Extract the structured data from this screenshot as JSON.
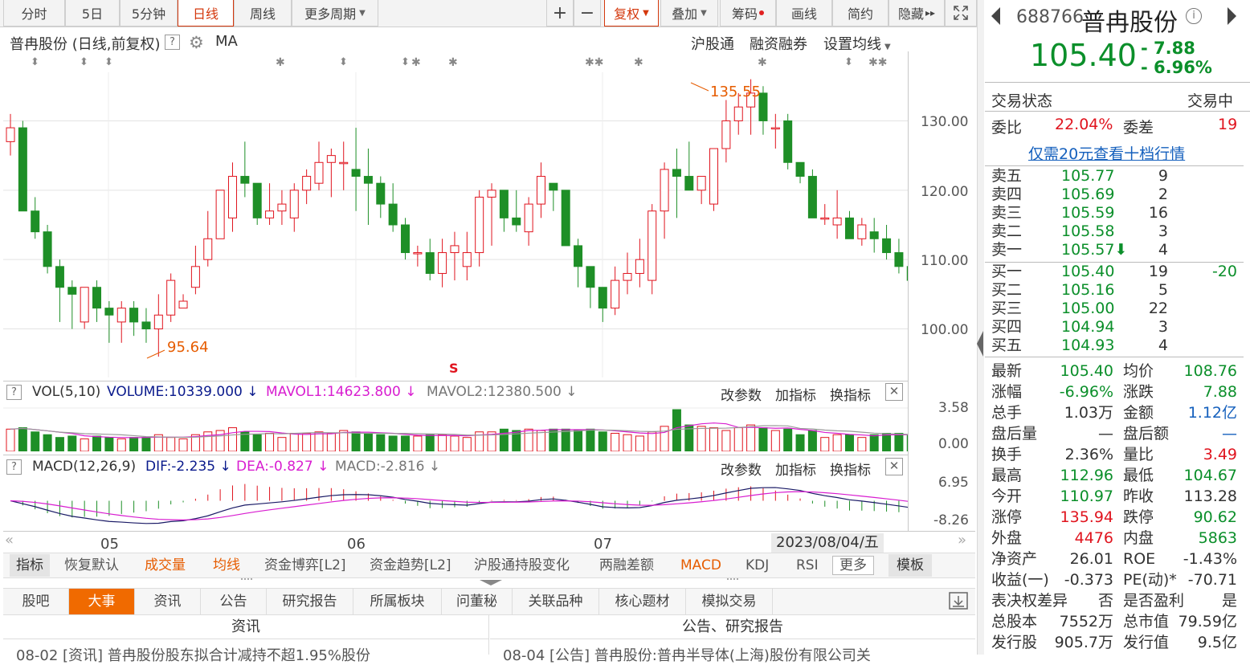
{
  "toolbar": {
    "tabs": [
      "分时",
      "5日",
      "5分钟",
      "日线",
      "周线",
      "更多周期"
    ],
    "right_tools": [
      "+",
      "−",
      "复权",
      "叠加",
      "筹码",
      "画线",
      "简约",
      "隐藏"
    ]
  },
  "chart_header": {
    "title": "普冉股份 (日线,前复权)",
    "ma": "MA",
    "links": [
      "沪股通",
      "融资融券",
      "设置均线"
    ]
  },
  "annotations": {
    "high_label": "135.55",
    "low_label": "95.64",
    "s_marker": "S"
  },
  "price_axis": [
    "130.00",
    "120.00",
    "110.00",
    "100.00"
  ],
  "vol_header": {
    "name": "VOL(5,10)",
    "volume": "VOLUME:10339.000",
    "mavol1": "MAVOL1:14623.800",
    "mavol2": "MAVOL2:12380.500",
    "axis_top": "3.58",
    "axis_bottom": "0.00"
  },
  "macd_header": {
    "name": "MACD(12,26,9)",
    "dif": "DIF:-2.235",
    "dea": "DEA:-0.827",
    "macd": "MACD:-2.816",
    "axis_top": "6.95",
    "axis_bottom": "-8.26"
  },
  "panel_actions": [
    "改参数",
    "加指标",
    "换指标"
  ],
  "time_axis": {
    "months": [
      "05",
      "06",
      "07"
    ],
    "cursor_date": "2023/08/04/五"
  },
  "indicator_tabs": [
    "指标",
    "恢复默认",
    "成交量",
    "均线",
    "资金博弈[L2]",
    "资金趋势[L2]",
    "沪股通持股变化",
    "两融差额",
    "MACD",
    "KDJ",
    "RSI",
    "更多",
    "模板"
  ],
  "bottom_tabs": [
    "股吧",
    "大事",
    "资讯",
    "公告",
    "研究报告",
    "所属板块",
    "问董秘",
    "关联品种",
    "核心题材",
    "模拟交易"
  ],
  "news": {
    "left_header": "资讯",
    "right_header": "公告、研究报告",
    "left_item": "08-02  [资讯]  普冉股份股东拟合计减持不超1.95%股份",
    "right_item": "08-04  [公告]  普冉股份:普冉半导体(上海)股份有限公司关"
  },
  "quote": {
    "code": "688766",
    "name": "普冉股份",
    "price": "105.40",
    "change": "- 7.88",
    "change_pct": "- 6.96%",
    "status_label": "交易状态",
    "status": "交易中",
    "weibi_label": "委比",
    "weibi": "22.04%",
    "weicha_label": "委差",
    "weicha": "19",
    "promo": "仅需20元查看十档行情"
  },
  "order_book": {
    "asks": [
      {
        "label": "卖五",
        "price": "105.77",
        "vol": "9"
      },
      {
        "label": "卖四",
        "price": "105.69",
        "vol": "2"
      },
      {
        "label": "卖三",
        "price": "105.59",
        "vol": "16"
      },
      {
        "label": "卖二",
        "price": "105.58",
        "vol": "3"
      },
      {
        "label": "卖一",
        "price": "105.57",
        "vol": "4"
      }
    ],
    "bids": [
      {
        "label": "买一",
        "price": "105.40",
        "vol": "19",
        "delta": "-20"
      },
      {
        "label": "买二",
        "price": "105.16",
        "vol": "5"
      },
      {
        "label": "买三",
        "price": "105.00",
        "vol": "22"
      },
      {
        "label": "买四",
        "price": "104.94",
        "vol": "3"
      },
      {
        "label": "买五",
        "price": "104.93",
        "vol": "4"
      }
    ]
  },
  "stats": [
    {
      "l1": "最新",
      "v1": "105.40",
      "c1": "green",
      "l2": "均价",
      "v2": "108.76",
      "c2": "green"
    },
    {
      "l1": "涨幅",
      "v1": "-6.96%",
      "c1": "green",
      "l2": "涨跌",
      "v2": "7.88",
      "c2": "green"
    },
    {
      "l1": "总手",
      "v1": "1.03万",
      "c1": "",
      "l2": "金额",
      "v2": "1.12亿",
      "c2": "blue"
    },
    {
      "l1": "盘后量",
      "v1": "—",
      "c1": "",
      "l2": "盘后额",
      "v2": "—",
      "c2": "blue"
    },
    {
      "l1": "换手",
      "v1": "2.36%",
      "c1": "",
      "l2": "量比",
      "v2": "3.49",
      "c2": "red"
    },
    {
      "l1": "最高",
      "v1": "112.96",
      "c1": "green",
      "l2": "最低",
      "v2": "104.67",
      "c2": "green"
    },
    {
      "l1": "今开",
      "v1": "110.97",
      "c1": "green",
      "l2": "昨收",
      "v2": "113.28",
      "c2": ""
    },
    {
      "l1": "涨停",
      "v1": "135.94",
      "c1": "red",
      "l2": "跌停",
      "v2": "90.62",
      "c2": "green"
    },
    {
      "l1": "外盘",
      "v1": "4476",
      "c1": "red",
      "l2": "内盘",
      "v2": "5863",
      "c2": "green"
    },
    {
      "l1": "净资产",
      "v1": "26.01",
      "c1": "",
      "l2": "ROE",
      "v2": "-1.43%",
      "c2": ""
    },
    {
      "l1": "收益(一)",
      "v1": "-0.373",
      "c1": "",
      "l2": "PE(动)*",
      "v2": "-70.71",
      "c2": ""
    },
    {
      "l1": "表决权差异",
      "v1": "否",
      "c1": "",
      "l2": "是否盈利",
      "v2": "是",
      "c2": ""
    },
    {
      "l1": "总股本",
      "v1": "7552万",
      "c1": "",
      "l2": "总市值",
      "v2": "79.59亿",
      "c2": ""
    },
    {
      "l1": "发行股",
      "v1": "905.7万",
      "c1": "",
      "l2": "发行值",
      "v2": "9.5亿",
      "c2": ""
    }
  ],
  "chart_data": {
    "type": "candlestick",
    "title": "普冉股份 (日线,前复权)",
    "ylim": [
      93,
      137
    ],
    "yticks": [
      100,
      110,
      120,
      130
    ],
    "note": "OHLC values approximated from price axis",
    "ohlc": [
      [
        127,
        131,
        125,
        129
      ],
      [
        129,
        130,
        117,
        117
      ],
      [
        117,
        119,
        113,
        114
      ],
      [
        114,
        115,
        108,
        109
      ],
      [
        109,
        110,
        101,
        106
      ],
      [
        106,
        107,
        100,
        105
      ],
      [
        101,
        106,
        100,
        106
      ],
      [
        106,
        107,
        101,
        103
      ],
      [
        103,
        104,
        98,
        102
      ],
      [
        101,
        104,
        98,
        103
      ],
      [
        103,
        104,
        99,
        101
      ],
      [
        101,
        103,
        98,
        100
      ],
      [
        100,
        105,
        96,
        102
      ],
      [
        102,
        108,
        101,
        107
      ],
      [
        103,
        105,
        103,
        104
      ],
      [
        106,
        112,
        105,
        109
      ],
      [
        110,
        117,
        109,
        113
      ],
      [
        113,
        120,
        113,
        120
      ],
      [
        116,
        124,
        114,
        122
      ],
      [
        122,
        127,
        119,
        121
      ],
      [
        121,
        121,
        115,
        116
      ],
      [
        116,
        121,
        115,
        117
      ],
      [
        117,
        120,
        115,
        118
      ],
      [
        116,
        121,
        114,
        120
      ],
      [
        120,
        123,
        118,
        122
      ],
      [
        121,
        127,
        120,
        124
      ],
      [
        124,
        126,
        119,
        125
      ],
      [
        124,
        127,
        120,
        124
      ],
      [
        123,
        129,
        117,
        122
      ],
      [
        122,
        126,
        115,
        121
      ],
      [
        121,
        122,
        116,
        118
      ],
      [
        118,
        121,
        114,
        115
      ],
      [
        115,
        116,
        110,
        111
      ],
      [
        111,
        112,
        109,
        111
      ],
      [
        111,
        113,
        107,
        108
      ],
      [
        108,
        113,
        106,
        111
      ],
      [
        111,
        114,
        107,
        112
      ],
      [
        109,
        114,
        107,
        111
      ],
      [
        111,
        120,
        109,
        119
      ],
      [
        119,
        121,
        112,
        120
      ],
      [
        120,
        120,
        114,
        116
      ],
      [
        116,
        120,
        114,
        115
      ],
      [
        114,
        119,
        112,
        118
      ],
      [
        118,
        124,
        116,
        122
      ],
      [
        121,
        121,
        117,
        120
      ],
      [
        120,
        119,
        112,
        112
      ],
      [
        112,
        113,
        106,
        109
      ],
      [
        109,
        108,
        103,
        106
      ],
      [
        106,
        106,
        101,
        103
      ],
      [
        103,
        109,
        102,
        107
      ],
      [
        107,
        111,
        105,
        108
      ],
      [
        108,
        113,
        106,
        110
      ],
      [
        107,
        118,
        105,
        117
      ],
      [
        117,
        124,
        113,
        123
      ],
      [
        123,
        126,
        116,
        122
      ],
      [
        122,
        127,
        120,
        120
      ],
      [
        120,
        121,
        118,
        122
      ],
      [
        118,
        126,
        117,
        126
      ],
      [
        126,
        133,
        124,
        130
      ],
      [
        130,
        134,
        128,
        132
      ],
      [
        132,
        136,
        128,
        134
      ],
      [
        134,
        135,
        128,
        130
      ],
      [
        129,
        131,
        126,
        129
      ],
      [
        130,
        131,
        123,
        124
      ],
      [
        124,
        124,
        121,
        122
      ],
      [
        122,
        123,
        116,
        116
      ],
      [
        116,
        118,
        115,
        116
      ],
      [
        115,
        120,
        113,
        116
      ],
      [
        116,
        117,
        113,
        113
      ],
      [
        113,
        116,
        112,
        115
      ],
      [
        114,
        116,
        111,
        113
      ],
      [
        113,
        115,
        110,
        111
      ],
      [
        111,
        113,
        108,
        109
      ],
      [
        109,
        111,
        106,
        107
      ],
      [
        106,
        112,
        105,
        110
      ],
      [
        110,
        112,
        107,
        109
      ],
      [
        111,
        116,
        108,
        112
      ],
      [
        112,
        113,
        104,
        105
      ]
    ],
    "volume_ylim": [
      0,
      3.58
    ],
    "volumes": [
      1.6,
      1.7,
      1.4,
      1.2,
      1.0,
      1.1,
      0.9,
      1.1,
      1.0,
      0.9,
      1.0,
      1.0,
      1.2,
      1.0,
      0.9,
      1.2,
      1.4,
      1.5,
      1.7,
      1.4,
      1.2,
      1.3,
      1.0,
      1.3,
      1.3,
      1.4,
      1.3,
      1.5,
      1.4,
      1.3,
      1.2,
      1.1,
      1.1,
      1.1,
      1.2,
      1.2,
      1.1,
      1.0,
      1.4,
      1.4,
      1.6,
      1.5,
      1.6,
      1.5,
      1.6,
      1.6,
      1.5,
      1.6,
      1.4,
      1.3,
      1.2,
      1.1,
      1.4,
      1.8,
      3.0,
      1.9,
      1.8,
      1.7,
      1.5,
      1.7,
      1.9,
      1.7,
      1.5,
      1.6,
      1.2,
      1.5,
      1.0,
      1.2,
      1.2,
      1.0,
      1.2,
      1.3,
      1.3,
      1.2,
      1.0,
      1.2,
      1.2,
      1.3
    ]
  }
}
